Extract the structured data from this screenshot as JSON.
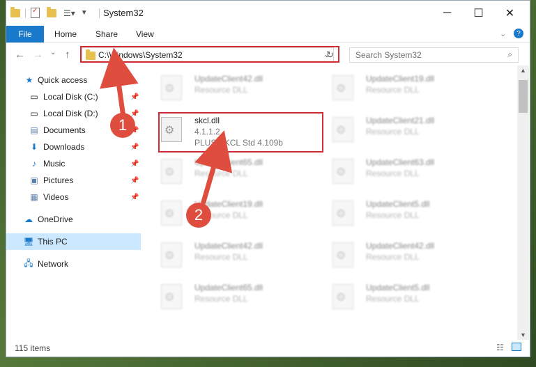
{
  "window": {
    "title": "System32",
    "controls": {
      "minimize": "─",
      "maximize": "☐",
      "close": "✕"
    }
  },
  "quick_access_toolbar": {
    "icons": [
      "folder-icon",
      "properties-icon",
      "new-folder-icon",
      "customize-icon"
    ]
  },
  "ribbon": {
    "tabs": [
      {
        "label": "File"
      },
      {
        "label": "Home"
      },
      {
        "label": "Share"
      },
      {
        "label": "View"
      }
    ]
  },
  "address_bar": {
    "path": "C:\\Windows\\System32",
    "search_placeholder": "Search System32"
  },
  "nav_pane": {
    "items": [
      {
        "label": "Quick access",
        "icon": "star-icon"
      },
      {
        "label": "Local Disk (C:)",
        "icon": "drive-icon",
        "pinned": true
      },
      {
        "label": "Local Disk (D:)",
        "icon": "drive-icon",
        "pinned": true
      },
      {
        "label": "Documents",
        "icon": "documents-icon",
        "pinned": true
      },
      {
        "label": "Downloads",
        "icon": "downloads-icon",
        "pinned": true
      },
      {
        "label": "Music",
        "icon": "music-icon",
        "pinned": true
      },
      {
        "label": "Pictures",
        "icon": "pictures-icon",
        "pinned": true
      },
      {
        "label": "Videos",
        "icon": "videos-icon",
        "pinned": true
      },
      {
        "label": "OneDrive",
        "icon": "cloud-icon"
      },
      {
        "label": "This PC",
        "icon": "pc-icon",
        "selected": true
      },
      {
        "label": "Network",
        "icon": "network-icon"
      }
    ]
  },
  "files": [
    {
      "name": "UpdateClient42.dll",
      "type": "Resource DLL"
    },
    {
      "name": "UpdateClient19.dll",
      "type": "Resource DLL"
    },
    {
      "name": "skcl.dll",
      "version": "4.1.1.2",
      "description": "PLUS SKCL Std 4.109b"
    },
    {
      "name": "UpdateClient21.dll",
      "type": "Resource DLL"
    },
    {
      "name": "UpdateClient65.dll",
      "type": "Resource DLL"
    },
    {
      "name": "UpdateClient63.dll",
      "type": "Resource DLL"
    },
    {
      "name": "UpdateClient19.dll",
      "type": "Resource DLL"
    },
    {
      "name": "UpdateClient5.dll",
      "type": "Resource DLL"
    },
    {
      "name": "UpdateClient42.dll",
      "type": "Resource DLL"
    },
    {
      "name": "UpdateClient42.dll",
      "type": "Resource DLL"
    },
    {
      "name": "UpdateClient65.dll",
      "type": "Resource DLL"
    },
    {
      "name": "UpdateClient5.dll",
      "type": "Resource DLL"
    }
  ],
  "status_bar": {
    "item_count": "115 items"
  },
  "annotations": {
    "step1": "1",
    "step2": "2",
    "highlight_color": "#d02b34",
    "badge_color": "#de4d3e"
  }
}
